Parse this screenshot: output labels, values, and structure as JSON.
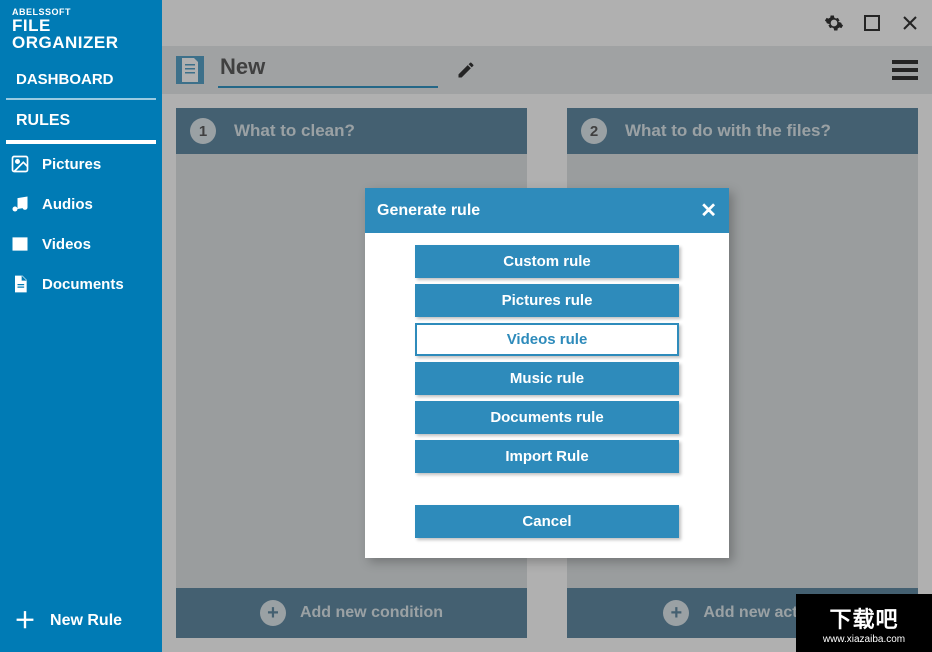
{
  "brand": {
    "top": "ABELSSOFT",
    "bottom": "FILE ORGANIZER"
  },
  "nav": {
    "dashboard": "DASHBOARD",
    "rules": "RULES",
    "items": [
      {
        "label": "Pictures"
      },
      {
        "label": "Audios"
      },
      {
        "label": "Videos"
      },
      {
        "label": "Documents"
      }
    ],
    "new_rule": "New Rule"
  },
  "header": {
    "rule_name": "New"
  },
  "panels": {
    "left": {
      "num": "1",
      "title": "What to clean?",
      "footer": "Add new condition"
    },
    "right": {
      "num": "2",
      "title": "What to do with the files?",
      "footer": "Add new action"
    }
  },
  "dialog": {
    "title": "Generate rule",
    "buttons": [
      "Custom rule",
      "Pictures rule",
      "Videos rule",
      "Music rule",
      "Documents rule",
      "Import Rule"
    ],
    "cancel": "Cancel"
  },
  "watermark": {
    "big": "下载吧",
    "url": "www.xiazaiba.com"
  }
}
